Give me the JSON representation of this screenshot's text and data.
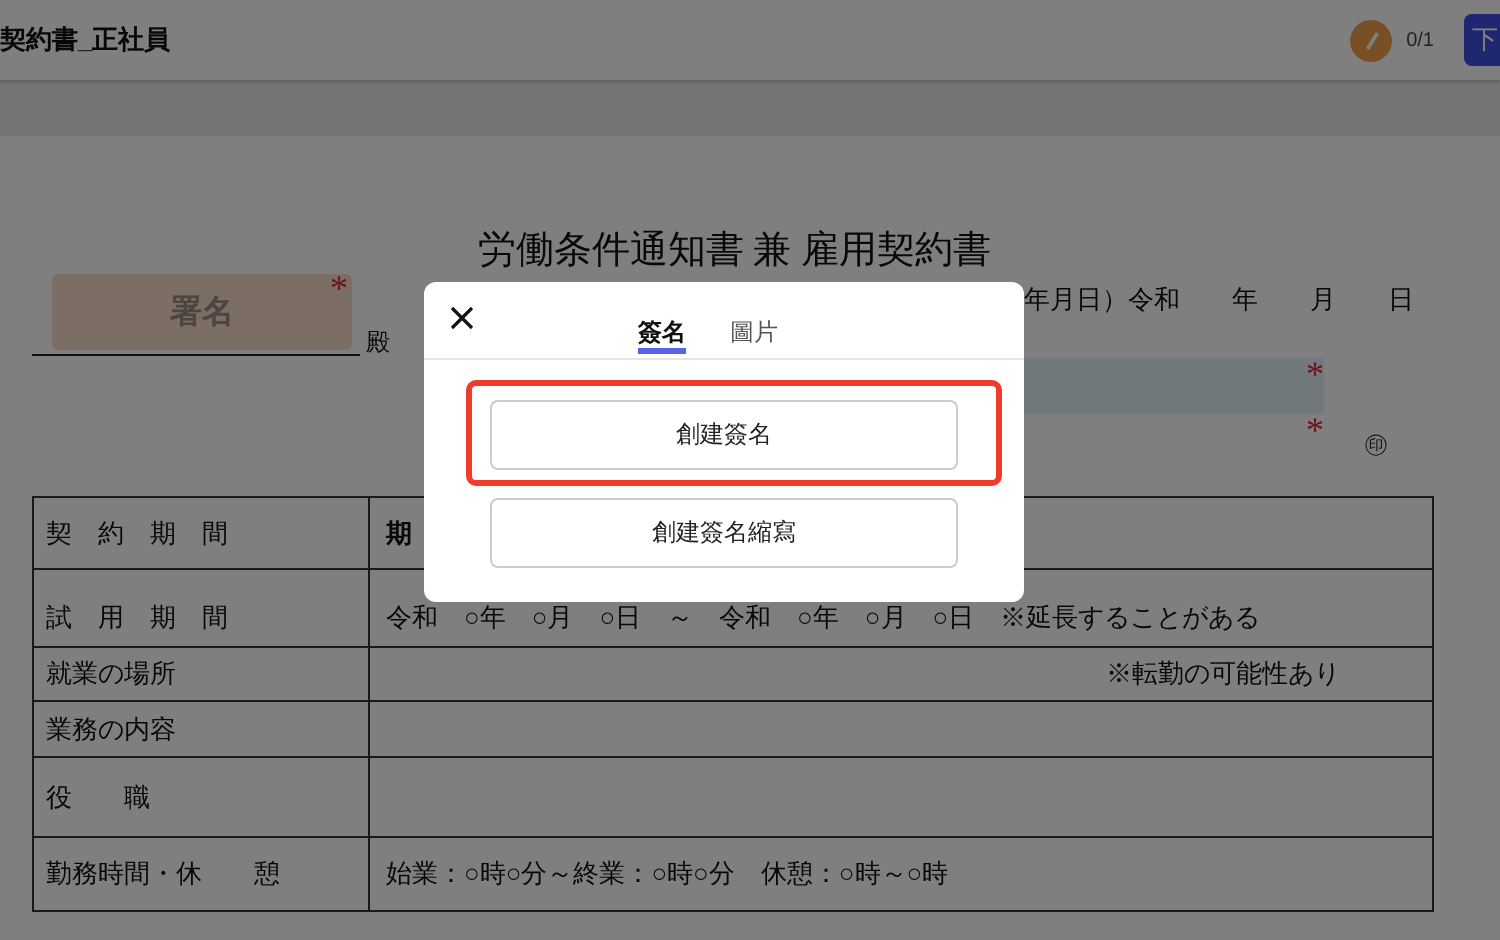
{
  "header": {
    "title": "契約書_正社員",
    "progress": "0/1",
    "action_button": "下"
  },
  "document": {
    "title": "労働条件通知書 兼 雇用契約書",
    "signature_field": {
      "label": "署名",
      "required_mark": "*"
    },
    "addressee_suffix": "殿",
    "date_line": "年月日）令和　　年　　月　　日",
    "signer_fields": [
      {
        "kind": "field",
        "required_mark": "*"
      },
      {
        "kind": "line",
        "required_mark": "*"
      }
    ],
    "seal": "㊞",
    "table": {
      "rows": [
        {
          "kind": "emphasis",
          "label": "契　約　期　間",
          "value": "期"
        },
        {
          "kind": "plain",
          "label": "試　用　期　間",
          "value": "令和　○年　○月　○日　～　令和　○年　○月　○日　※延長することがある"
        },
        {
          "kind": "note",
          "label": "就業の場所",
          "value": "※転勤の可能性あり"
        },
        {
          "kind": "plain",
          "label": "業務の内容"
        },
        {
          "kind": "plain",
          "label": "役　　職"
        },
        {
          "kind": "plain",
          "label": "勤務時間・休　　憩",
          "value": "始業：○時○分～終業：○時○分　休憩：○時～○時"
        }
      ]
    }
  },
  "dialog": {
    "tabs": [
      {
        "label": "簽名",
        "selected": true
      },
      {
        "label": "圖片",
        "selected": false
      }
    ],
    "buttons": [
      {
        "label": "創建簽名",
        "highlighted": true
      },
      {
        "label": "創建簽名縮寫",
        "highlighted": false
      }
    ]
  }
}
